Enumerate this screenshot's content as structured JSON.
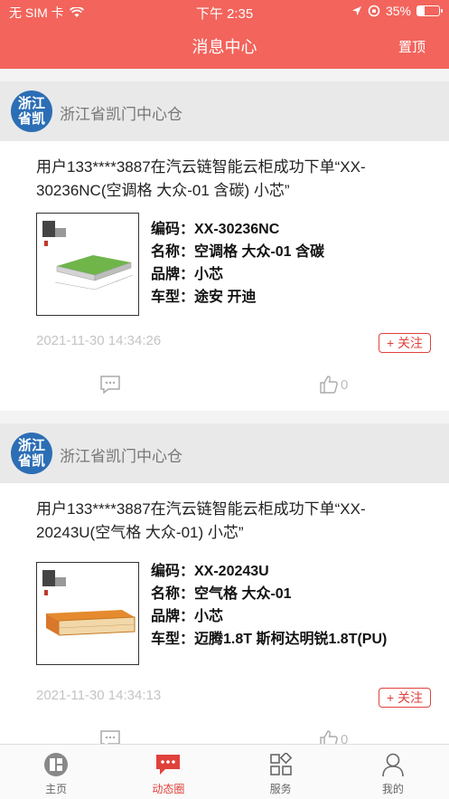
{
  "status_bar": {
    "carrier": "无 SIM 卡",
    "time": "下午 2:35",
    "battery": "35%",
    "battery_level": 0.35
  },
  "header": {
    "title": "消息中心",
    "pin_label": "置顶"
  },
  "feed": [
    {
      "avatar_text": "浙江省凯",
      "store_name": "浙江省凯门中心仓",
      "message": "用户133****3887在汽云链智能云柜成功下单“XX-30236NC(空调格 大众-01 含碳) 小芯”",
      "code": "编码：XX-30236NC",
      "name": "名称：空调格 大众-01 含碳",
      "brand": "品牌：小芯",
      "model": "车型：途安 开迪",
      "date": "2021-11-30 14:34:26",
      "follow_label": "+ 关注",
      "likes": "0"
    },
    {
      "avatar_text": "浙江省凯",
      "store_name": "浙江省凯门中心仓",
      "message": "用户133****3887在汽云链智能云柜成功下单“XX-20243U(空气格 大众-01) 小芯”",
      "code": "编码：XX-20243U",
      "name": "名称：空气格 大众-01",
      "brand": "品牌：小芯",
      "model": "车型：迈腾1.8T 斯柯达明锐1.8T(PU)",
      "date": "2021-11-30 14:34:13",
      "follow_label": "+ 关注",
      "likes": "0"
    }
  ],
  "tabs": [
    {
      "label": "主页",
      "icon": "home-icon"
    },
    {
      "label": "动态圈",
      "icon": "chat-bubble-icon"
    },
    {
      "label": "服务",
      "icon": "services-grid-icon"
    },
    {
      "label": "我的",
      "icon": "user-icon"
    }
  ],
  "colors": {
    "brand": "#f2645c",
    "accent": "#e0413b",
    "avatar": "#2c6eb5"
  }
}
